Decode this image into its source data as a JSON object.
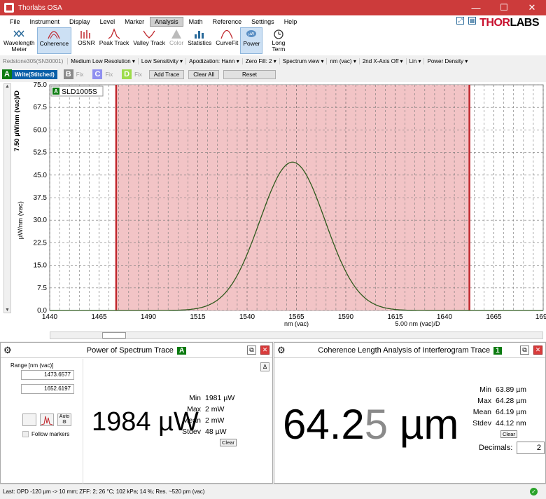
{
  "window": {
    "title": "Thorlabs OSA",
    "min_label": "—",
    "max_label": "☐",
    "close_label": "✕"
  },
  "logo": {
    "part1": "THOR",
    "part2": "LABS"
  },
  "menu": [
    "File",
    "Instrument",
    "Display",
    "Level",
    "Marker",
    "Analysis",
    "Math",
    "Reference",
    "Settings",
    "Help"
  ],
  "menu_active": "Analysis",
  "ribbon": [
    {
      "label": "Wavelength\nMeter",
      "icon": "wavelength-meter-icon",
      "selected": false,
      "disabled": false
    },
    {
      "label": "Coherence",
      "icon": "coherence-icon",
      "selected": true,
      "disabled": false
    },
    {
      "label": "OSNR",
      "icon": "osnr-icon",
      "selected": false,
      "disabled": false
    },
    {
      "label": "Peak Track",
      "icon": "peak-track-icon",
      "selected": false,
      "disabled": false
    },
    {
      "label": "Valley Track",
      "icon": "valley-track-icon",
      "selected": false,
      "disabled": false
    },
    {
      "label": "Color",
      "icon": "color-icon",
      "selected": false,
      "disabled": true
    },
    {
      "label": "Statistics",
      "icon": "statistics-icon",
      "selected": false,
      "disabled": false
    },
    {
      "label": "CurveFit",
      "icon": "curvefit-icon",
      "selected": false,
      "disabled": false
    },
    {
      "label": "Power",
      "icon": "power-icon",
      "selected": true,
      "disabled": false
    },
    {
      "label": "Long\nTerm",
      "icon": "long-term-icon",
      "selected": false,
      "disabled": false
    }
  ],
  "settings": {
    "device": "Redstone305(SN30001)",
    "resolution": "Medium Low Resolution",
    "sensitivity": "Low Sensitivity",
    "apodization": "Apodization: Hann",
    "zero_fill": "Zero Fill: 2",
    "spectrum_view": "Spectrum view",
    "unit": "nm (vac)",
    "second_axis": "2nd X-Axis Off",
    "scale": "Lin",
    "density": "Power Density"
  },
  "traces": [
    {
      "tag": "A",
      "label": "Write(Stitched)",
      "color": "#0b7a10",
      "active": true
    },
    {
      "tag": "B",
      "label": "Fix",
      "color": "#8a8a8a",
      "active": false
    },
    {
      "tag": "C",
      "label": "Fix",
      "color": "#8f8ff0",
      "active": false
    },
    {
      "tag": "D",
      "label": "Fix",
      "color": "#9ddc4a",
      "active": false
    }
  ],
  "trace_buttons": {
    "add": "Add Trace",
    "clear": "Clear All",
    "reset": "Reset"
  },
  "chart_data": {
    "type": "line",
    "legend_tag": "A",
    "legend_label": "SLD1005S",
    "ylabel": "µW/nm (vac)",
    "ydiv_label": "7.50 µW/nm (vac)/D",
    "xlabel": "nm (vac)",
    "xdiv_label": "5.00 nm (vac)/D",
    "ylim": [
      0,
      75
    ],
    "yticks": [
      0.0,
      7.5,
      15.0,
      22.5,
      30.0,
      37.5,
      45.0,
      52.5,
      60.0,
      67.5,
      75.0
    ],
    "xlim": [
      1440,
      1690
    ],
    "xticks": [
      1440,
      1465,
      1490,
      1515,
      1540,
      1565,
      1590,
      1615,
      1640,
      1665,
      1690
    ],
    "marker_band": [
      1473.6577,
      1652.6197
    ],
    "series": [
      {
        "color": "#2f5a1d",
        "peak_x": 1563,
        "peak_y": 49.3,
        "sigma": 16.5,
        "baseline": 0
      }
    ],
    "band_color": "#f2c4c6",
    "marker_color": "#c0272d"
  },
  "power_panel": {
    "title": "Power of Spectrum Trace",
    "tag": "A",
    "range_label": "Range [nm (vac)]",
    "range_min": "1473.6577",
    "range_max": "1652.6197",
    "auto_label": "Auto",
    "follow_markers": "Follow markers",
    "value": "1984 µW",
    "stats": [
      {
        "k": "Min",
        "v": "1981 µW"
      },
      {
        "k": "Max",
        "v": "2 mW"
      },
      {
        "k": "Mean",
        "v": "2 mW"
      },
      {
        "k": "Stdev",
        "v": "48 µW"
      }
    ],
    "clear": "Clear",
    "collapse": "Δ"
  },
  "coherence_panel": {
    "title": "Coherence Length Analysis of Interferogram Trace",
    "tag": "1",
    "value_main": "64.2",
    "value_faded": "5",
    "value_unit": " µm",
    "stats": [
      {
        "k": "Min",
        "v": "63.89 µm"
      },
      {
        "k": "Max",
        "v": "64.28 µm"
      },
      {
        "k": "Mean",
        "v": "64.19 µm"
      },
      {
        "k": "Stdev",
        "v": "44.12 nm"
      }
    ],
    "clear": "Clear",
    "decimals_label": "Decimals:",
    "decimals_value": "2"
  },
  "status": {
    "text": "Last: OPD -120 µm -> 10 mm; ZFF: 2; 26 °C; 102 kPa; 14 %; Res. ~520 pm (vac)"
  }
}
